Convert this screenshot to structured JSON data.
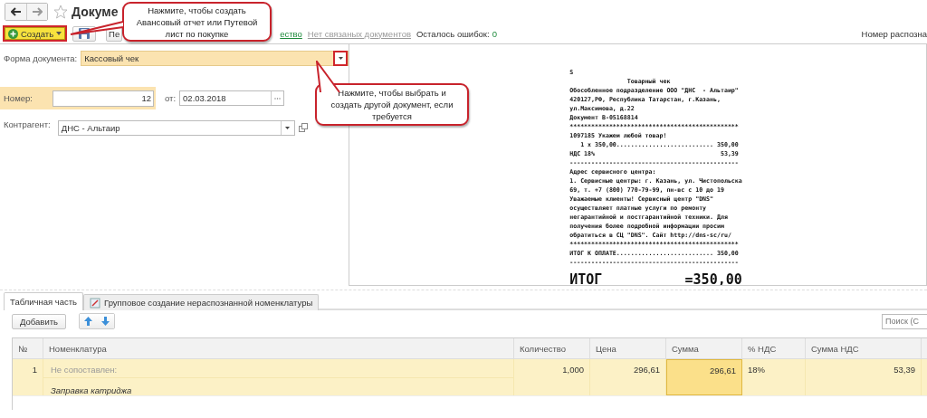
{
  "header": {
    "title": "Докуме"
  },
  "toolbar": {
    "create_button": "Создать",
    "button_2": "Пе",
    "link_1": "ество",
    "related_link": "Нет связаных документов",
    "errors_label": "Осталось ошибок:",
    "errors_count": "0",
    "recognized_label": "Номер распозна"
  },
  "form": {
    "doc_form": {
      "label": "Форма документа:",
      "value": "Кассовый чек"
    },
    "number": {
      "label": "Номер:",
      "value": "12"
    },
    "date": {
      "label": "от:",
      "value": "02.03.2018"
    },
    "counterparty": {
      "label": "Контрагент:",
      "value": "ДНС - Альтаир"
    }
  },
  "receipt": {
    "lines": [
      "S",
      "                Товарный чек",
      "Обособленное подразделение ООО \"ДНС  - Альтаир\"",
      "420127,РФ, Республика Татарстан, г.Казань,",
      "ул.Максимова, д.22",
      "Документ В-05168814",
      "***********************************************",
      "1097185 Укажем любой товар!",
      "   1 x 350,00........................... 350,00",
      "НДС 18%                                   53,39",
      "-----------------------------------------------",
      "Адрес сервисного центра:",
      "1. Сервисные центры: г. Казань, ул. Чистопольска",
      "69, т. +7 (800) 770-79-99, пн-вс с 10 до 19",
      "Уважаемые клиенты! Сервисный центр \"DNS\"",
      "осуществляет платные услуги по ремонту",
      "негарантийной и постгарантийной техники. Для",
      "получения более подробной информации просим",
      "обратиться в СЦ \"DNS\". Сайт http://dns-sc/ru/",
      "***********************************************",
      "ИТОГ К ОПЛАТЕ........................... 350,00",
      "-----------------------------------------------"
    ],
    "total_label": "ИТОГ",
    "total_value": "=350,00"
  },
  "callouts": [
    {
      "text": "Нажмите, чтобы создать Авансовый отчет или Путевой лист по покупке"
    },
    {
      "text": "Нажмите, чтобы выбрать и создать другой документ, если требуется"
    }
  ],
  "tabs": [
    {
      "label": "Табличная часть",
      "selected": true
    },
    {
      "label": "Групповое создание нераспознанной номенклатуры",
      "selected": false
    }
  ],
  "table_toolbar": {
    "add_button": "Добавить",
    "search": {
      "placeholder": "Поиск (С"
    }
  },
  "table": {
    "columns": [
      "№",
      "Номенклатура",
      "Количество",
      "Цена",
      "Сумма",
      "% НДС",
      "Сумма НДС"
    ],
    "rows": [
      {
        "selected": true,
        "cells": [
          {
            "text": "1",
            "focused": false
          },
          {
            "text": "Не сопоставлен:",
            "note": "Заправка катриджа",
            "focused": false
          },
          {
            "text": "1,000",
            "focused": false
          },
          {
            "text": "296,61",
            "focused": false
          },
          {
            "text": "296,61",
            "focused": true
          },
          {
            "text": "18%",
            "focused": false
          },
          {
            "text": "53,39",
            "focused": false
          }
        ]
      }
    ]
  }
}
